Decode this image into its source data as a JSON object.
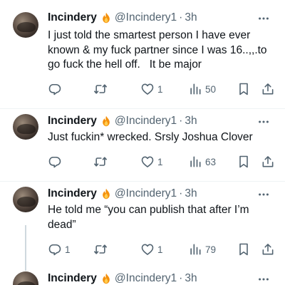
{
  "tweets": [
    {
      "name": "Incindery",
      "handle": "@Incindery1",
      "separator": "·",
      "time": "3h",
      "text": "I just told the smartest person I have ever known & my fuck partner since I was 16..,,.to go fuck the hell off.   It be major",
      "replies": "",
      "retweets": "",
      "likes": "1",
      "views": "50"
    },
    {
      "name": "Incindery",
      "handle": "@Incindery1",
      "separator": "·",
      "time": "3h",
      "text": "Just fuckin* wrecked. Srsly Joshua Clover",
      "replies": "",
      "retweets": "",
      "likes": "1",
      "views": "63"
    },
    {
      "name": "Incindery",
      "handle": "@Incindery1",
      "separator": "·",
      "time": "3h",
      "text": "He told me “you can publish that after I’m dead”",
      "replies": "1",
      "retweets": "",
      "likes": "1",
      "views": "79"
    },
    {
      "name": "Incindery",
      "handle": "@Incindery1",
      "separator": "·",
      "time": "3h",
      "text": ""
    }
  ],
  "colors": {
    "text": "#0f1419",
    "secondary": "#536471",
    "divider": "#eff3f4",
    "thread_line": "#cfd9de",
    "flame": "#f4900c"
  },
  "icons": {
    "name_badge": "fire-emoji-icon",
    "more": "more-dots-icon",
    "reply": "reply-icon",
    "retweet": "retweet-icon",
    "like": "heart-icon",
    "views": "views-chart-icon",
    "bookmark": "bookmark-icon",
    "share": "share-icon"
  }
}
